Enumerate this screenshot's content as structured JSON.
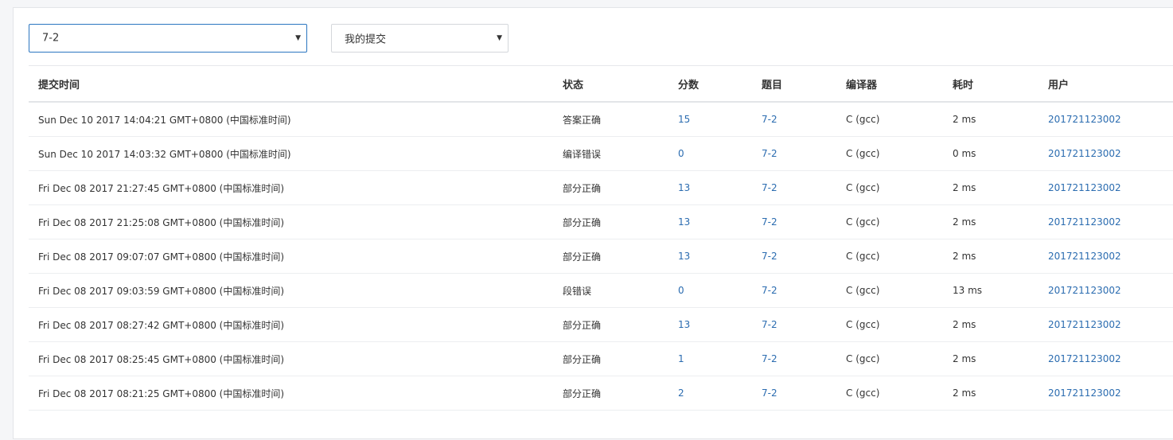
{
  "filters": {
    "problem": "7-2",
    "scope": "我的提交",
    "caret": "▼"
  },
  "table": {
    "headers": [
      "提交时间",
      "状态",
      "分数",
      "题目",
      "编译器",
      "耗时",
      "用户"
    ],
    "rows": [
      {
        "time": "Sun Dec 10 2017 14:04:21 GMT+0800 (中国标准时间)",
        "status": "答案正确",
        "status_type": "accepted",
        "score": "15",
        "problem": "7-2",
        "compiler": "C (gcc)",
        "duration": "2 ms",
        "user": "201721123002"
      },
      {
        "time": "Sun Dec 10 2017 14:03:32 GMT+0800 (中国标准时间)",
        "status": "编译错误",
        "status_type": "compile",
        "score": "0",
        "problem": "7-2",
        "compiler": "C (gcc)",
        "duration": "0 ms",
        "user": "201721123002"
      },
      {
        "time": "Fri Dec 08 2017 21:27:45 GMT+0800 (中国标准时间)",
        "status": "部分正确",
        "status_type": "partial",
        "score": "13",
        "problem": "7-2",
        "compiler": "C (gcc)",
        "duration": "2 ms",
        "user": "201721123002"
      },
      {
        "time": "Fri Dec 08 2017 21:25:08 GMT+0800 (中国标准时间)",
        "status": "部分正确",
        "status_type": "partial",
        "score": "13",
        "problem": "7-2",
        "compiler": "C (gcc)",
        "duration": "2 ms",
        "user": "201721123002"
      },
      {
        "time": "Fri Dec 08 2017 09:07:07 GMT+0800 (中国标准时间)",
        "status": "部分正确",
        "status_type": "partial",
        "score": "13",
        "problem": "7-2",
        "compiler": "C (gcc)",
        "duration": "2 ms",
        "user": "201721123002"
      },
      {
        "time": "Fri Dec 08 2017 09:03:59 GMT+0800 (中国标准时间)",
        "status": "段错误",
        "status_type": "segfault",
        "score": "0",
        "problem": "7-2",
        "compiler": "C (gcc)",
        "duration": "13 ms",
        "user": "201721123002"
      },
      {
        "time": "Fri Dec 08 2017 08:27:42 GMT+0800 (中国标准时间)",
        "status": "部分正确",
        "status_type": "partial",
        "score": "13",
        "problem": "7-2",
        "compiler": "C (gcc)",
        "duration": "2 ms",
        "user": "201721123002"
      },
      {
        "time": "Fri Dec 08 2017 08:25:45 GMT+0800 (中国标准时间)",
        "status": "部分正确",
        "status_type": "partial",
        "score": "1",
        "problem": "7-2",
        "compiler": "C (gcc)",
        "duration": "2 ms",
        "user": "201721123002"
      },
      {
        "time": "Fri Dec 08 2017 08:21:25 GMT+0800 (中国标准时间)",
        "status": "部分正确",
        "status_type": "partial",
        "score": "2",
        "problem": "7-2",
        "compiler": "C (gcc)",
        "duration": "2 ms",
        "user": "201721123002"
      }
    ]
  },
  "colors": {
    "accepted": "#d9413a",
    "compile_error": "#2a9fd6",
    "partial": "#4aa24a",
    "link": "#2b6cb0",
    "select_focus_border": "#2b76c0"
  }
}
